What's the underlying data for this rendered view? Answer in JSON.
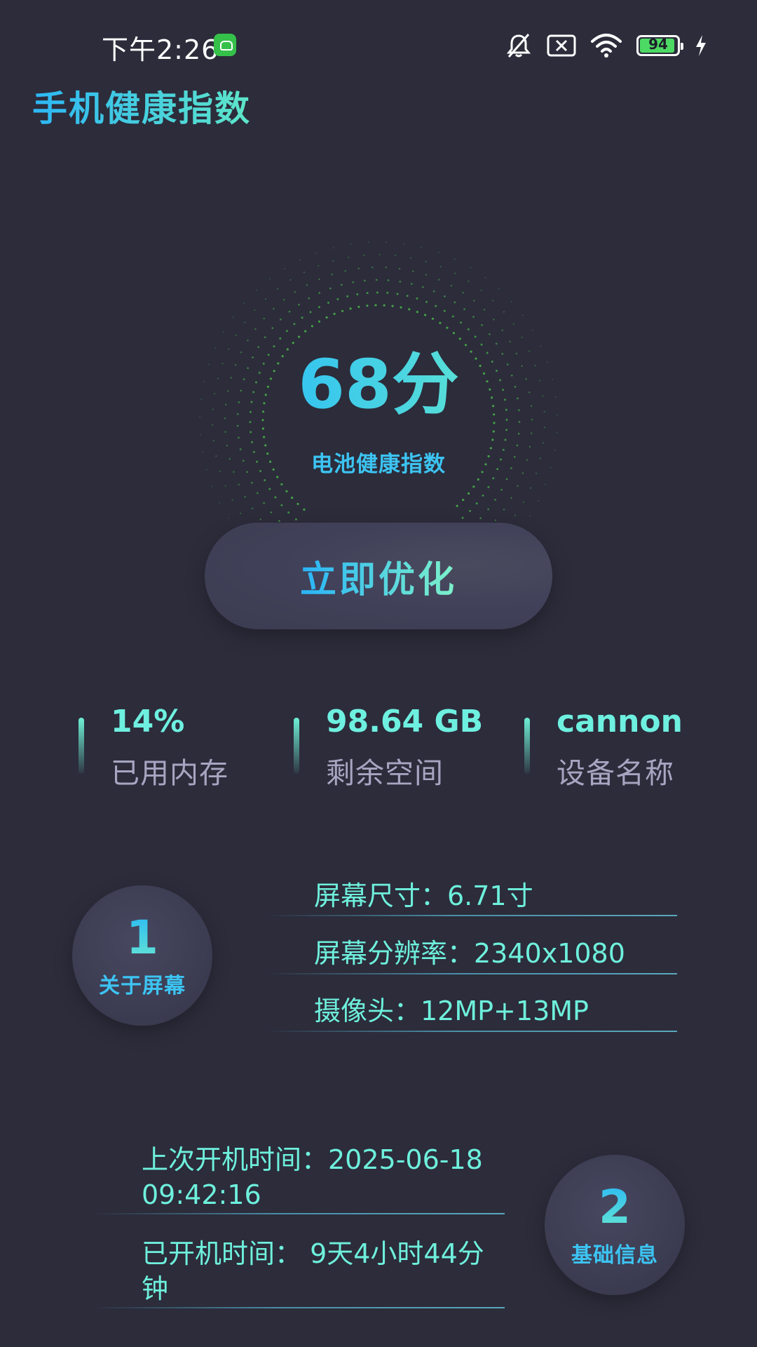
{
  "status_bar": {
    "time": "下午2:26",
    "battery": "94",
    "battery_level": 0.94,
    "icons": [
      "app-notification-icon",
      "bell-muted-icon",
      "sim-off-icon",
      "wifi-icon",
      "battery-icon",
      "charging-icon"
    ]
  },
  "app_title": "手机健康指数",
  "gauge": {
    "score": "68分",
    "caption": "电池健康指数",
    "accent_start": "#1fb3ff",
    "accent_end": "#6ef0c8",
    "dot_color": "#4cc74a"
  },
  "optimize_button": {
    "label": "立即优化"
  },
  "stats": [
    {
      "value": "14%",
      "label": "已用内存"
    },
    {
      "value": "98.64 GB",
      "label": "剩余空间"
    },
    {
      "value": "cannon",
      "label": "设备名称"
    }
  ],
  "section_screen": {
    "number": "1",
    "title": "关于屏幕",
    "rows": [
      "屏幕尺寸：6.71寸",
      "屏幕分辨率：2340x1080",
      "摄像头：12MP+13MP"
    ]
  },
  "section_basic": {
    "number": "2",
    "title": "基础信息",
    "rows": [
      {
        "line1": "上次开机时间：2025-06-18",
        "line2": "09:42:16"
      },
      {
        "line1": "已开机时间：  9天4小时44分",
        "line2": "钟"
      }
    ]
  },
  "colors": {
    "background": "#2c2c3b",
    "accent_blue": "#28b4f8",
    "accent_mint": "#6ef0dc",
    "muted_label": "#a6a6c2"
  }
}
